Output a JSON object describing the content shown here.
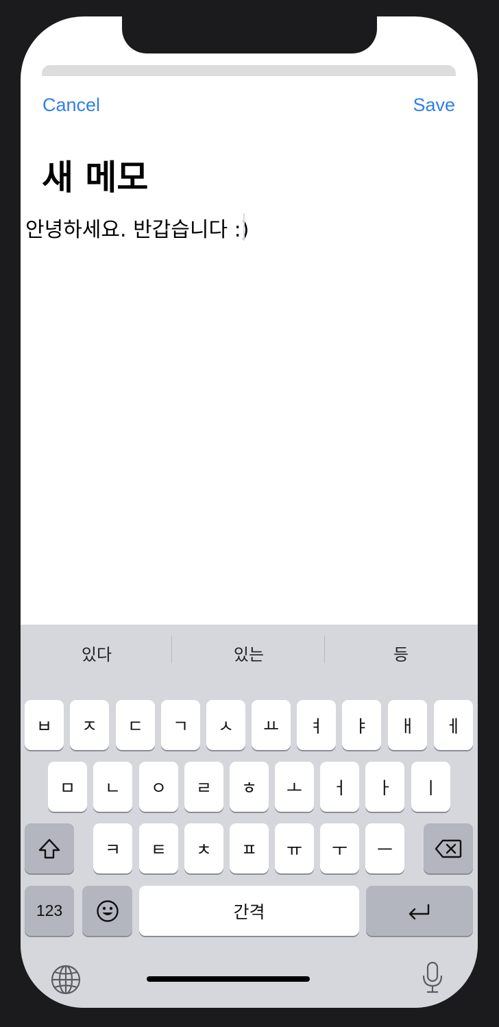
{
  "nav": {
    "cancel_label": "Cancel",
    "save_label": "Save"
  },
  "title": "새 메모",
  "memo_text": "안녕하세요. 반갑습니다 :)",
  "keyboard": {
    "suggestions": [
      "있다",
      "있는",
      "등"
    ],
    "row1": [
      "ㅂ",
      "ㅈ",
      "ㄷ",
      "ㄱ",
      "ㅅ",
      "ㅛ",
      "ㅕ",
      "ㅑ",
      "ㅐ",
      "ㅔ"
    ],
    "row2": [
      "ㅁ",
      "ㄴ",
      "ㅇ",
      "ㄹ",
      "ㅎ",
      "ㅗ",
      "ㅓ",
      "ㅏ",
      "ㅣ"
    ],
    "row3": [
      "ㅋ",
      "ㅌ",
      "ㅊ",
      "ㅍ",
      "ㅠ",
      "ㅜ",
      "ㅡ"
    ],
    "numbers_label": "123",
    "space_label": "간격",
    "icons": {
      "shift": "shift-icon",
      "delete": "delete-icon",
      "emoji": "emoji-icon",
      "return": "return-icon",
      "globe": "globe-icon",
      "mic": "microphone-icon"
    }
  }
}
